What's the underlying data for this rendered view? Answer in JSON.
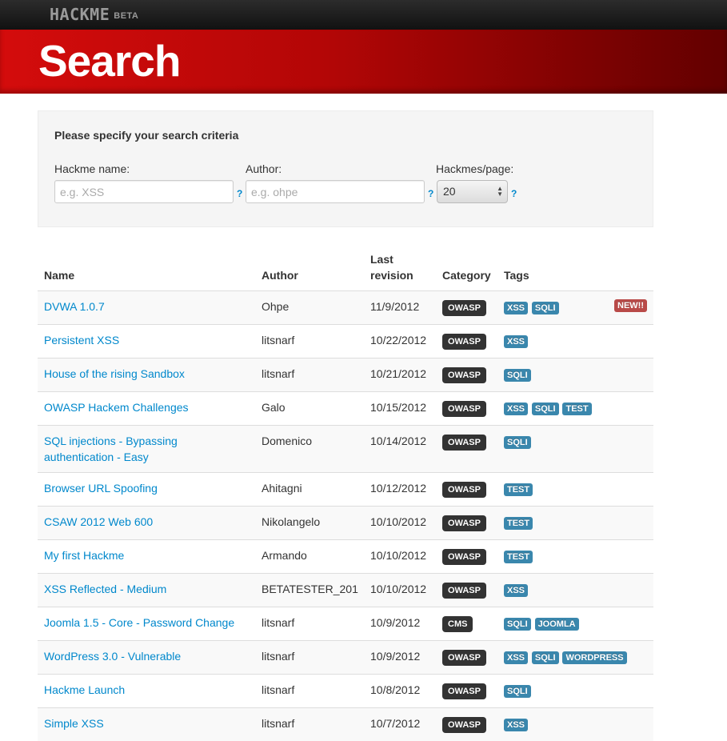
{
  "brand": {
    "name": "HACKME",
    "badge": "BETA"
  },
  "page_title": "Search",
  "search": {
    "heading": "Please specify your search criteria",
    "name_label": "Hackme name:",
    "name_placeholder": "e.g. XSS",
    "author_label": "Author:",
    "author_placeholder": "e.g. ohpe",
    "per_page_label": "Hackmes/page:",
    "per_page_value": "20",
    "help_glyph": "?"
  },
  "table": {
    "headers": {
      "name": "Name",
      "author": "Author",
      "revision_line1": "Last",
      "revision_line2": "revision",
      "category": "Category",
      "tags": "Tags"
    },
    "new_badge": "NEW!!",
    "rows": [
      {
        "name": "DVWA 1.0.7",
        "author": "Ohpe",
        "revision": "11/9/2012",
        "category": "OWASP",
        "tags": [
          "XSS",
          "SQLI"
        ],
        "is_new": true
      },
      {
        "name": "Persistent XSS",
        "author": "litsnarf",
        "revision": "10/22/2012",
        "category": "OWASP",
        "tags": [
          "XSS"
        ]
      },
      {
        "name": "House of the rising Sandbox",
        "author": "litsnarf",
        "revision": "10/21/2012",
        "category": "OWASP",
        "tags": [
          "SQLI"
        ]
      },
      {
        "name": "OWASP Hackem Challenges",
        "author": "Galo",
        "revision": "10/15/2012",
        "category": "OWASP",
        "tags": [
          "XSS",
          "SQLI",
          "TEST"
        ]
      },
      {
        "name": "SQL injections - Bypassing authentication - Easy",
        "author": "Domenico",
        "revision": "10/14/2012",
        "category": "OWASP",
        "tags": [
          "SQLI"
        ]
      },
      {
        "name": "Browser URL Spoofing",
        "author": "Ahitagni",
        "revision": "10/12/2012",
        "category": "OWASP",
        "tags": [
          "TEST"
        ]
      },
      {
        "name": "CSAW 2012 Web 600",
        "author": "Nikolangelo",
        "revision": "10/10/2012",
        "category": "OWASP",
        "tags": [
          "TEST"
        ]
      },
      {
        "name": "My first Hackme",
        "author": "Armando",
        "revision": "10/10/2012",
        "category": "OWASP",
        "tags": [
          "TEST"
        ]
      },
      {
        "name": "XSS Reflected - Medium",
        "author": "BETATESTER_201",
        "revision": "10/10/2012",
        "category": "OWASP",
        "tags": [
          "XSS"
        ]
      },
      {
        "name": "Joomla 1.5 - Core - Password Change",
        "author": "litsnarf",
        "revision": "10/9/2012",
        "category": "CMS",
        "tags": [
          "SQLI",
          "JOOMLA"
        ]
      },
      {
        "name": "WordPress 3.0 - Vulnerable",
        "author": "litsnarf",
        "revision": "10/9/2012",
        "category": "OWASP",
        "tags": [
          "XSS",
          "SQLI",
          "WORDPRESS"
        ]
      },
      {
        "name": "Hackme Launch",
        "author": "litsnarf",
        "revision": "10/8/2012",
        "category": "OWASP",
        "tags": [
          "SQLI"
        ]
      },
      {
        "name": "Simple XSS",
        "author": "litsnarf",
        "revision": "10/7/2012",
        "category": "OWASP",
        "tags": [
          "XSS"
        ]
      }
    ]
  }
}
